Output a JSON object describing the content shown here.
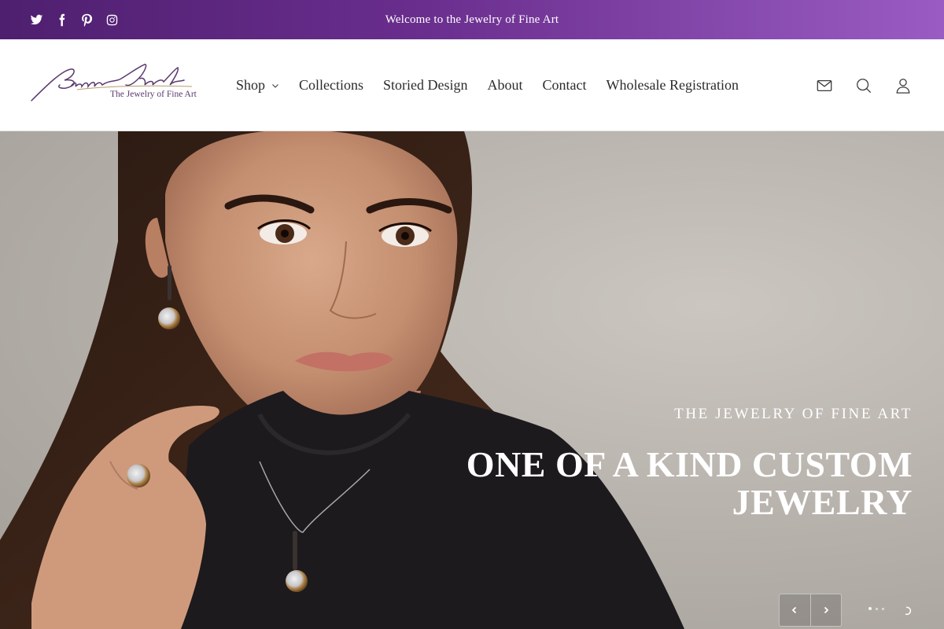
{
  "announcement": {
    "text": "Welcome to the Jewelry of Fine Art"
  },
  "social": [
    {
      "icon": "twitter-icon"
    },
    {
      "icon": "facebook-icon"
    },
    {
      "icon": "pinterest-icon"
    },
    {
      "icon": "instagram-icon"
    }
  ],
  "brand": {
    "script_name": "Brenda Smith",
    "tagline": "The Jewelry of Fine Art"
  },
  "nav": {
    "items": [
      {
        "label": "Shop",
        "has_dropdown": true
      },
      {
        "label": "Collections"
      },
      {
        "label": "Storied Design"
      },
      {
        "label": "About"
      },
      {
        "label": "Contact"
      },
      {
        "label": "Wholesale Registration"
      }
    ]
  },
  "header_icons": [
    "mail-icon",
    "search-icon",
    "account-icon"
  ],
  "hero": {
    "eyebrow": "THE JEWELRY OF FINE ART",
    "title": "ONE OF A KIND CUSTOM JEWELRY",
    "slide_count": 3,
    "active_slide": 1
  },
  "colors": {
    "topbar_start": "#4e1f6f",
    "topbar_end": "#9a5cc2",
    "text": "#2b2b2b",
    "logo_purple": "#5b3a6e"
  }
}
